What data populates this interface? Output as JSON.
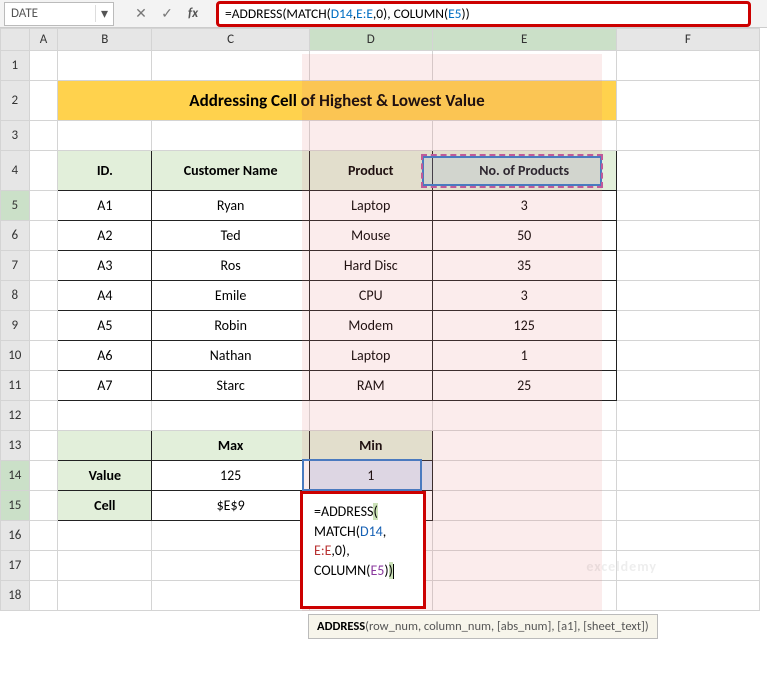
{
  "namebox": "DATE",
  "formula_bar": "=ADDRESS(MATCH(D14,E:E,0), COLUMN(E5))",
  "formula_parts": {
    "p1": "=ADDRESS(MATCH(",
    "ref1": "D14",
    "p2": ",",
    "ref2": "E:E",
    "p3": ",0), COLUMN(",
    "ref3": "E5",
    "p4": "))"
  },
  "columns": {
    "A": "A",
    "B": "B",
    "C": "C",
    "D": "D",
    "E": "E",
    "F": "F"
  },
  "rows": [
    "1",
    "2",
    "3",
    "4",
    "5",
    "6",
    "7",
    "8",
    "9",
    "10",
    "11",
    "12",
    "13",
    "14",
    "15",
    "16",
    "17",
    "18"
  ],
  "title": "Addressing Cell of Highest & Lowest Value",
  "headers": {
    "id": "ID.",
    "cname": "Customer Name",
    "product": "Product",
    "nprod": "No. of Products"
  },
  "data": [
    {
      "id": "A1",
      "name": "Ryan",
      "product": "Laptop",
      "n": "3"
    },
    {
      "id": "A2",
      "name": "Ted",
      "product": "Mouse",
      "n": "50"
    },
    {
      "id": "A3",
      "name": "Ros",
      "product": "Hard Disc",
      "n": "35"
    },
    {
      "id": "A4",
      "name": "Emile",
      "product": "CPU",
      "n": "3"
    },
    {
      "id": "A5",
      "name": "Robin",
      "product": "Modem",
      "n": "125"
    },
    {
      "id": "A6",
      "name": "Nathan",
      "product": "Laptop",
      "n": "1"
    },
    {
      "id": "A7",
      "name": "Starc",
      "product": "RAM",
      "n": "25"
    }
  ],
  "summary": {
    "max_label": "Max",
    "min_label": "Min",
    "value_label": "Value",
    "cell_label": "Cell",
    "max_value": "125",
    "min_value": "1",
    "max_cell": "$E$9"
  },
  "editing_formula": {
    "line1a": "=ADDRESS",
    "line1b": "(",
    "line2a": "MATCH(",
    "line2ref": "D14",
    "line2b": ",",
    "line3ref": "E:E",
    "line3a": ",0),",
    "line4a": "COLUMN(",
    "line4ref": "E5",
    "line4b": ")",
    "line4c": ")"
  },
  "tooltip": {
    "fn": "ADDRESS",
    "args": "(row_num, column_num, [abs_num], [a1], [sheet_text])"
  },
  "icons": {
    "cancel": "✕",
    "confirm": "✓",
    "fx": "fx",
    "dd": "▾"
  }
}
